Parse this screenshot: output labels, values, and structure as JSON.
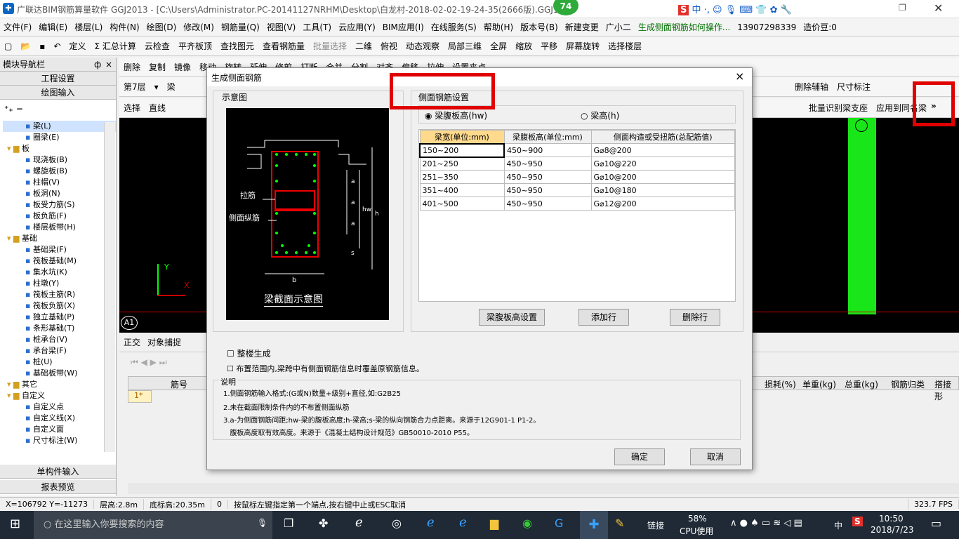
{
  "window": {
    "title": "广联达BIM钢筋算量软件 GGJ2013 - [C:\\Users\\Administrator.PC-20141127NRHM\\Desktop\\白龙村-2018-02-02-19-24-35(2666版).GGJ12]",
    "badge": "74"
  },
  "menu": [
    "文件(F)",
    "编辑(E)",
    "楼层(L)",
    "构件(N)",
    "绘图(D)",
    "修改(M)",
    "钢筋量(Q)",
    "视图(V)",
    "工具(T)",
    "云应用(Y)",
    "BIM应用(I)",
    "在线服务(S)",
    "帮助(H)",
    "版本号(B)",
    "新建变更",
    "广小二"
  ],
  "menu_right": {
    "link": "生成侧面钢筋如何操作...",
    "phone": "13907298339",
    "beans": "造价豆:0"
  },
  "toolbar1": [
    "定义",
    "Σ 汇总计算",
    "云检查",
    "平齐板顶",
    "查找图元",
    "查看钢筋量",
    "批量选择",
    "二维",
    "俯视",
    "动态观察",
    "局部三维",
    "全屏",
    "缩放",
    "平移",
    "屏幕旋转",
    "选择楼层"
  ],
  "toolbar2": [
    "删除",
    "复制",
    "镜像",
    "移动",
    "旋转",
    "延伸",
    "修剪",
    "打断",
    "合并",
    "分割",
    "对齐",
    "偏移",
    "拉伸",
    "设置夹点"
  ],
  "toolbar3": {
    "floor": "第7层",
    "type": "梁",
    "right": [
      "删除辅轴",
      "尺寸标注"
    ]
  },
  "toolbar4": {
    "left": [
      "选择",
      "直线"
    ],
    "right": [
      "批量识别梁支座",
      "应用到同名梁"
    ],
    "more": "»"
  },
  "sidebar": {
    "title": "模块导航栏",
    "pin": "ф",
    "close": "×",
    "btn1": "工程设置",
    "btn2": "绘图输入",
    "bottom1": "单构件输入",
    "bottom2": "报表预览",
    "tree": [
      {
        "t": "梁(L)",
        "l": 3
      },
      {
        "t": "圈梁(E)",
        "l": 3
      },
      {
        "t": "板",
        "l": 1
      },
      {
        "t": "现浇板(B)",
        "l": 3
      },
      {
        "t": "螺旋板(B)",
        "l": 3
      },
      {
        "t": "柱帽(V)",
        "l": 3
      },
      {
        "t": "板洞(N)",
        "l": 3
      },
      {
        "t": "板受力筋(S)",
        "l": 3
      },
      {
        "t": "板负筋(F)",
        "l": 3
      },
      {
        "t": "楼层板带(H)",
        "l": 3
      },
      {
        "t": "基础",
        "l": 1
      },
      {
        "t": "基础梁(F)",
        "l": 3
      },
      {
        "t": "筏板基础(M)",
        "l": 3
      },
      {
        "t": "集水坑(K)",
        "l": 3
      },
      {
        "t": "柱墩(Y)",
        "l": 3
      },
      {
        "t": "筏板主筋(R)",
        "l": 3
      },
      {
        "t": "筏板负筋(X)",
        "l": 3
      },
      {
        "t": "独立基础(P)",
        "l": 3
      },
      {
        "t": "条形基础(T)",
        "l": 3
      },
      {
        "t": "桩承台(V)",
        "l": 3
      },
      {
        "t": "承台梁(F)",
        "l": 3
      },
      {
        "t": "桩(U)",
        "l": 3
      },
      {
        "t": "基础板带(W)",
        "l": 3
      },
      {
        "t": "其它",
        "l": 1
      },
      {
        "t": "自定义",
        "l": 1
      },
      {
        "t": "自定义点",
        "l": 3
      },
      {
        "t": "自定义线(X)",
        "l": 3
      },
      {
        "t": "自定义面",
        "l": 3
      },
      {
        "t": "尺寸标注(W)",
        "l": 3
      }
    ]
  },
  "canvas": {
    "axis_y": "Y",
    "axis_x": "X",
    "axis_label": "A1"
  },
  "bottom": {
    "tools": [
      "正交",
      "对象捕捉"
    ],
    "headers_left": [
      "筋号"
    ],
    "row1": "1*",
    "headers_right": [
      "损耗(%)",
      "单重(kg)",
      "总重(kg)",
      "钢筋归类",
      "搭接形"
    ]
  },
  "status": [
    "X=106792 Y=-11273",
    "层高:2.8m",
    "底标高:20.35m",
    "0",
    "按鼠标左键指定第一个端点,按右键中止或ESC取消",
    "323.7 FPS"
  ],
  "dialog": {
    "title": "生成侧面钢筋",
    "close": "×",
    "diagram_group": "示意图",
    "diagram": {
      "label1": "拉筋",
      "label2": "侧面纵筋",
      "a": "a",
      "hw": "hw",
      "h": "h",
      "s": "s",
      "b": "b",
      "caption": "梁截面示意图"
    },
    "settings_group": "侧面钢筋设置",
    "radio1": "梁腹板高(hw)",
    "radio2": "梁高(h)",
    "table": {
      "headers": [
        "梁宽(单位:mm)",
        "梁腹板高(单位:mm)",
        "侧面构造或受扭筋(总配筋值)"
      ],
      "rows": [
        [
          "150~200",
          "450~900",
          "G⌀8@200"
        ],
        [
          "201~250",
          "450~950",
          "G⌀10@220"
        ],
        [
          "251~350",
          "450~950",
          "G⌀10@200"
        ],
        [
          "351~400",
          "450~950",
          "G⌀10@180"
        ],
        [
          "401~500",
          "450~950",
          "G⌀12@200"
        ]
      ]
    },
    "btn_web": "梁腹板高设置",
    "btn_add": "添加行",
    "btn_del": "删除行",
    "check1": "整楼生成",
    "check2": "布置范围内,梁跨中有侧面钢筋信息时覆盖原钢筋信息。",
    "notes_title": "说明",
    "notes": [
      "1.侧面钢筋输入格式:(G或N)数量+级别+直径,如:G2B25",
      "2.未在截面限制条件内的不布置侧面纵筋",
      "3.a-为侧面钢筋间距;hw-梁的腹板高度;h-梁高;s-梁的纵向钢筋合力点距离。来源于12G901-1 P1-2。",
      "   腹板高度取有效高度。来源于《混凝土结构设计规范》GB50010-2010 P55。"
    ],
    "ok": "确定",
    "cancel": "取消"
  },
  "taskbar": {
    "search": "在这里输入你要搜索的内容",
    "link": "链接",
    "cpu": "58%",
    "cpu_label": "CPU使用",
    "ime": "中",
    "time": "10:50",
    "date": "2018/7/23"
  },
  "colors": {
    "highlight": "#e00000",
    "green": "#19e619",
    "header_orange": "#ffd98c"
  }
}
